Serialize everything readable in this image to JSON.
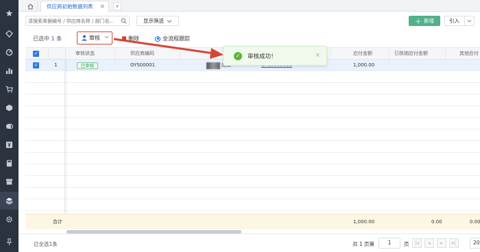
{
  "tabs": {
    "home_icon": "home-icon",
    "active_tab": "供应商初始数据列表",
    "close_glyph": "×",
    "more_glyph": "∨"
  },
  "toolbar": {
    "search_placeholder": "请搜索单据编号 / 供应商名称 / 部门名...",
    "filter_label": "显示筛选",
    "new_label": "新增",
    "import_label": "引入"
  },
  "actions": {
    "selected_prefix": "已选中",
    "selected_count": "1",
    "selected_suffix": "条",
    "audit_label": "审核",
    "delete_label": "删除",
    "trace_label": "全流程跟踪"
  },
  "table": {
    "headers": [
      "审核状态",
      "供应商编码",
      "应付金额",
      "已核销应付金额",
      "其他应付"
    ],
    "rows": [
      {
        "index": "1",
        "status": "已审核",
        "supplier_code": "GYS00001",
        "name_suffix": "应商",
        "doc_link": "GYS0000011",
        "amount": "1,000.00"
      }
    ],
    "total_label": "合计",
    "totals": {
      "amount": "1,000.00",
      "written_off": "0.00",
      "other": "0.00"
    }
  },
  "footer": {
    "all_selected": "已全选1条",
    "total_pages": "共 1 页第",
    "page_value": "1",
    "page_unit": "页",
    "page_size": "20"
  },
  "toast": {
    "message": "审核成功！",
    "close_glyph": "×"
  },
  "colors": {
    "accent": "#1b6bd1",
    "success": "#52b08b",
    "annotation": "#d64535",
    "sidebar": "#2b3340"
  }
}
